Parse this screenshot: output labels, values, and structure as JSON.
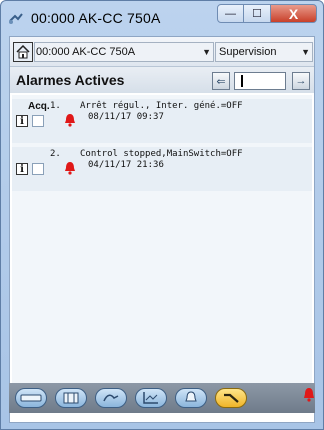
{
  "window": {
    "title": "00:000 AK-CC 750A",
    "minimize_glyph": "—",
    "maximize_glyph": "☐",
    "close_glyph": "X"
  },
  "toolbar": {
    "device_selected": "00:000 AK-CC 750A",
    "view_selected": "Supervision"
  },
  "header": {
    "title": "Alarmes Actives",
    "prev_glyph": "⇐",
    "next_glyph": "→"
  },
  "alarms": [
    {
      "ack_label": "Acq.",
      "number": "1.",
      "message": "Arrêt régul., Inter. géné.=OFF",
      "timestamp": "08/11/17 09:37",
      "info_glyph": "i"
    },
    {
      "ack_label": "",
      "number": "2.",
      "message": "Control stopped,MainSwitch=OFF",
      "timestamp": "04/11/17 21:36",
      "info_glyph": "i"
    }
  ],
  "actions": {
    "delete_glyph": "✕",
    "refresh_glyph": "⇅",
    "prev_glyph": "◀",
    "next_glyph": "▶"
  },
  "nav_icons": [
    "controller-icon",
    "display-icon",
    "sensor-icon",
    "graph-icon",
    "alarm-bell-icon",
    "tools-icon"
  ],
  "colors": {
    "alarm_red": "#e01818",
    "active_nav": "#f0b428"
  }
}
